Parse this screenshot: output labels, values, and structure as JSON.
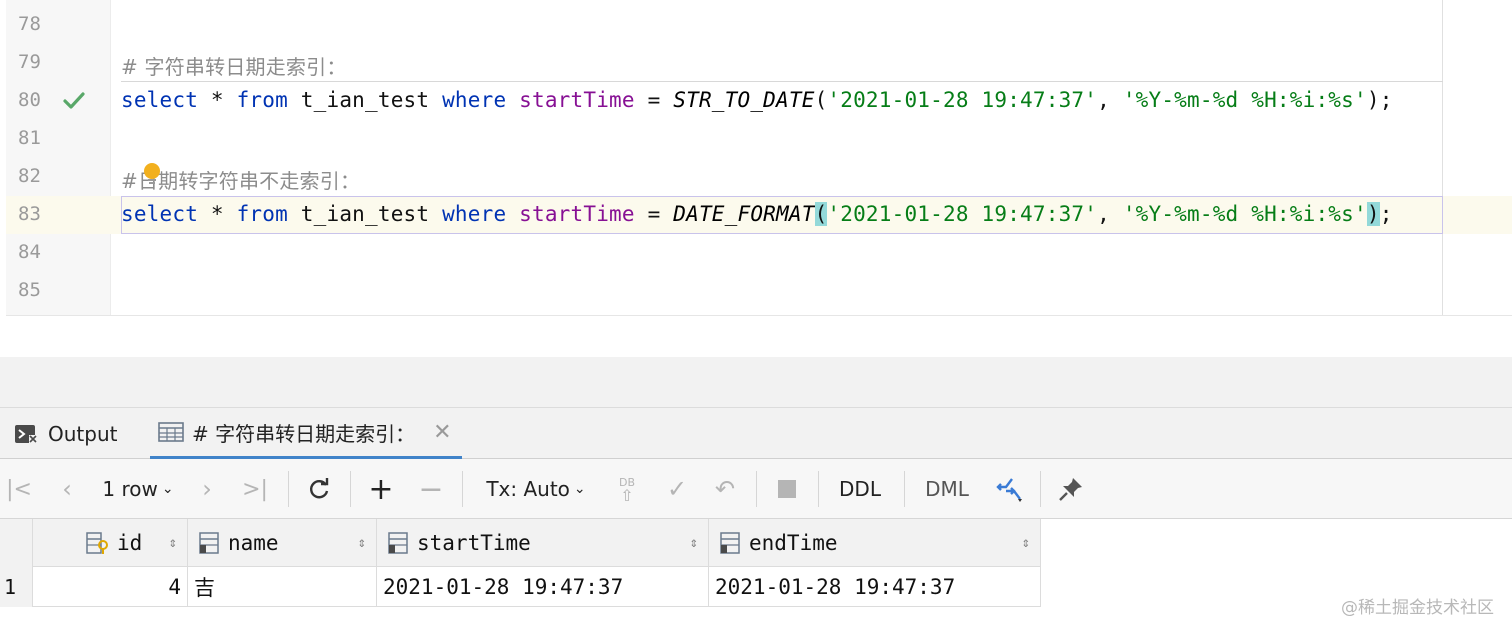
{
  "editor": {
    "lines": [
      {
        "num": "78"
      },
      {
        "num": "79",
        "comment": "# 字符串转日期走索引："
      },
      {
        "num": "80",
        "kw1": "select",
        "op1": " * ",
        "kw2": "from",
        "tbl": " t_ian_test ",
        "kw3": "where",
        "fld": " startTime",
        "eq": " = ",
        "fn": "STR_TO_DATE",
        "p1": "(",
        "s1": "'2021-01-28 19:47:37'",
        "comma": ", ",
        "s2": "'%Y-%m-%d %H:%i:%s'",
        "p2": ")",
        "semi": ";"
      },
      {
        "num": "81"
      },
      {
        "num": "82",
        "comment": "#日期转字符串不走索引："
      },
      {
        "num": "83",
        "kw1": "select",
        "op1": " * ",
        "kw2": "from",
        "tbl": " t_ian_test ",
        "kw3": "where",
        "fld": " startTime",
        "eq": " = ",
        "fn": "DATE_FORMAT",
        "p1": "(",
        "s1": "'2021-01-28 19:47:37'",
        "comma": ", ",
        "s2": "'%Y-%m-%d %H:%i:%s'",
        "p2": ")",
        "semi": ";"
      },
      {
        "num": "84"
      },
      {
        "num": "85"
      }
    ]
  },
  "tabs": {
    "output": "Output",
    "result": "# 字符串转日期走索引："
  },
  "toolbar": {
    "rows": "1 row",
    "tx": "Tx: Auto",
    "ddl": "DDL",
    "dml": "DML",
    "db_badge": "DB"
  },
  "grid": {
    "columns": [
      "id",
      "name",
      "startTime",
      "endTime"
    ],
    "rows": [
      {
        "num": "1",
        "id": "4",
        "name": "吉",
        "startTime": "2021-01-28 19:47:37",
        "endTime": "2021-01-28 19:47:37"
      }
    ]
  },
  "watermark": "@稀土掘金技术社区",
  "colors": {
    "keyword": "#0033b3",
    "field": "#871094",
    "string": "#067d17",
    "comment": "#8c8c8c",
    "accent": "#4083c9",
    "check": "#59a869",
    "bulb": "#f2b01e"
  }
}
